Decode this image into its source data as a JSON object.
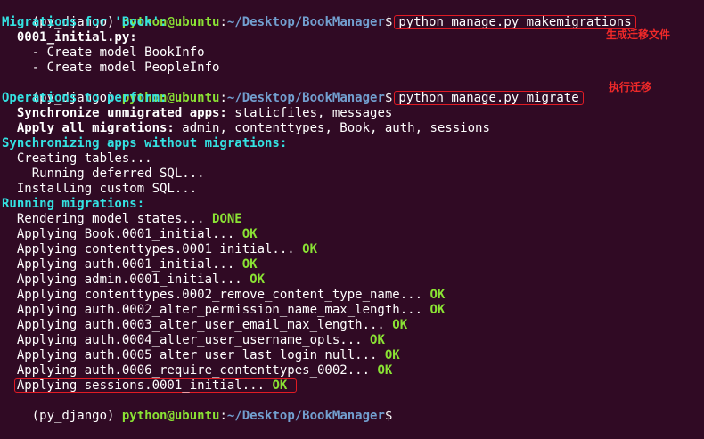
{
  "prompt": {
    "env": "(py_django) ",
    "user_host": "python@ubuntu",
    "colon": ":",
    "path": "~/Desktop/BookManager",
    "symbol": "$"
  },
  "commands": {
    "makemigrations": "python manage.py makemigrations",
    "migrate": "python manage.py migrate"
  },
  "annotations": {
    "makemigrations": "生成迁移文件",
    "migrate": "执行迁移"
  },
  "makemigrations_output": {
    "header": "Migrations for 'Book':",
    "file": "  0001_initial.py:",
    "item1": "    - Create model BookInfo",
    "item2": "    - Create model PeopleInfo"
  },
  "migrate_output": {
    "ops_header": "Operations to perform:",
    "sync_label": "  Synchronize unmigrated apps:",
    "sync_value": " staticfiles, messages",
    "apply_label": "  Apply all migrations:",
    "apply_value": " admin, contenttypes, Book, auth, sessions",
    "sync_header": "Synchronizing apps without migrations:",
    "creating": "  Creating tables...",
    "deferred": "    Running deferred SQL...",
    "custom": "  Installing custom SQL...",
    "running_header": "Running migrations:",
    "rendering": "  Rendering model states... ",
    "done": "DONE",
    "ok": "OK",
    "applying": [
      "  Applying Book.0001_initial... ",
      "  Applying contenttypes.0001_initial... ",
      "  Applying auth.0001_initial... ",
      "  Applying admin.0001_initial... ",
      "  Applying contenttypes.0002_remove_content_type_name... ",
      "  Applying auth.0002_alter_permission_name_max_length... ",
      "  Applying auth.0003_alter_user_email_max_length... ",
      "  Applying auth.0004_alter_user_username_opts... ",
      "  Applying auth.0005_alter_user_last_login_null... ",
      "  Applying auth.0006_require_contenttypes_0002... "
    ],
    "last_applying": "Applying sessions.0001_initial... "
  },
  "colors": {
    "background": "#300a24",
    "prompt_user": "#8ae234",
    "prompt_path": "#729fcf",
    "heading_cyan": "#34e2e2",
    "ok_green": "#8ae234",
    "annotation_red": "#ef2929"
  }
}
